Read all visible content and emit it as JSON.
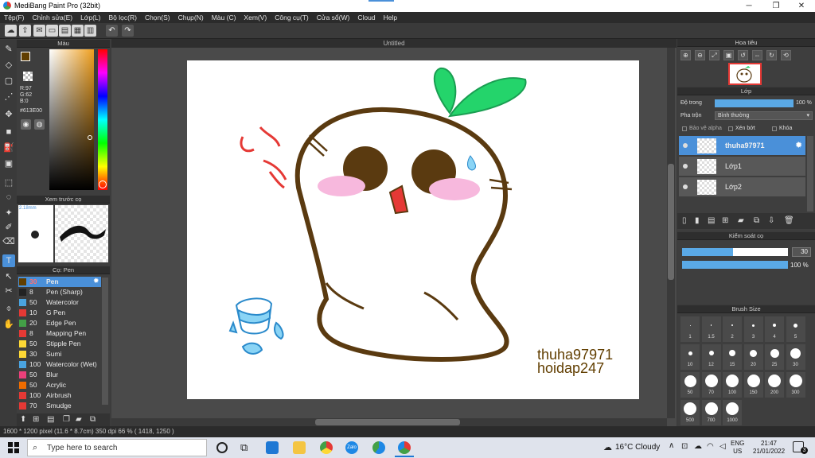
{
  "window": {
    "title": "MediBang Paint Pro (32bit)"
  },
  "menu": [
    "Tệp(F)",
    "Chỉnh sửa(E)",
    "Lớp(L)",
    "Bộ lọc(R)",
    "Chọn(S)",
    "Chụp(N)",
    "Màu (C)",
    "Xem(V)",
    "Công cụ(T)",
    "Cửa sổ(W)",
    "Cloud",
    "Help"
  ],
  "color_panel": {
    "title": "Màu",
    "rgb": {
      "r": "R:97",
      "g": "G:62",
      "b": "B:0"
    },
    "hex": "#613E00",
    "main_color": "#613E00"
  },
  "preview_panel": {
    "title": "Xem trước cọ",
    "size": "2.18mm"
  },
  "brush_panel": {
    "title": "Cọ: Pen",
    "items": [
      {
        "size": "30",
        "name": "Pen",
        "color": "#613E00"
      },
      {
        "size": "8",
        "name": "Pen (Sharp)",
        "color": "#222222"
      },
      {
        "size": "50",
        "name": "Watercolor",
        "color": "#4aa3df"
      },
      {
        "size": "10",
        "name": "G Pen",
        "color": "#e53935"
      },
      {
        "size": "20",
        "name": "Edge Pen",
        "color": "#43a047"
      },
      {
        "size": "8",
        "name": "Mapping Pen",
        "color": "#e53935"
      },
      {
        "size": "50",
        "name": "Stipple Pen",
        "color": "#fdd835"
      },
      {
        "size": "30",
        "name": "Sumi",
        "color": "#fdd835"
      },
      {
        "size": "100",
        "name": "Watercolor (Wet)",
        "color": "#4aa3df"
      },
      {
        "size": "50",
        "name": "Blur",
        "color": "#ec407a"
      },
      {
        "size": "50",
        "name": "Acrylic",
        "color": "#ef6c00"
      },
      {
        "size": "100",
        "name": "Airbrush",
        "color": "#e53935"
      },
      {
        "size": "70",
        "name": "Smudge",
        "color": "#e53935"
      }
    ]
  },
  "canvas": {
    "tab_title": "Untitled",
    "watermark_line1": "thuha97971",
    "watermark_line2": "hoidap247"
  },
  "navigator": {
    "title": "Hoa tiêu"
  },
  "layers": {
    "title": "Lớp",
    "opacity_label": "Độ trong",
    "opacity_value": "100 %",
    "blend_label": "Pha trộn",
    "blend_value": "Bình thường",
    "protect_alpha": "Bảo vệ alpha",
    "clipping": "Xén bớt",
    "lock": "Khóa",
    "items": [
      {
        "name": "thuha97971",
        "selected": true
      },
      {
        "name": "Lớp1",
        "selected": false
      },
      {
        "name": "Lớp2",
        "selected": false
      }
    ]
  },
  "brush_control": {
    "title": "Kiểm soát cọ",
    "size_value": "30",
    "size_fraction": 0.48,
    "opacity_value": "100 %",
    "opacity_fraction": 1.0
  },
  "brush_size": {
    "title": "Brush Size",
    "sizes": [
      "1",
      "1.5",
      "2",
      "3",
      "4",
      "5",
      "10",
      "12",
      "15",
      "20",
      "25",
      "30",
      "50",
      "70",
      "100",
      "150",
      "200",
      "300",
      "500",
      "700",
      "1000"
    ]
  },
  "status": {
    "text": "1600 * 1200 pixel   (11.6 * 8.7cm)   350 dpi   66 %   ( 1418, 1250 )"
  },
  "taskbar": {
    "search_placeholder": "Type here to search",
    "weather": "16°C  Cloudy",
    "lang1": "ENG",
    "lang2": "US",
    "time": "21:47",
    "date": "21/01/2022",
    "notification_count": "3"
  }
}
